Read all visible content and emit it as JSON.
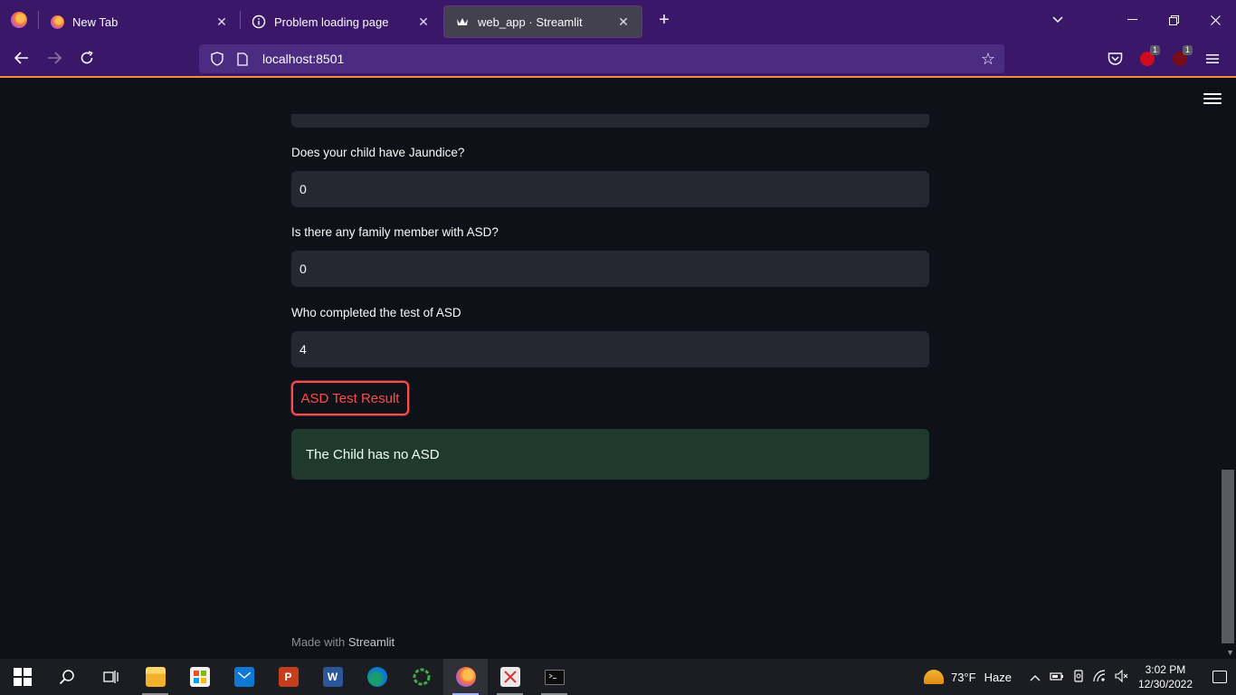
{
  "browser": {
    "tabs": [
      {
        "title": "New Tab",
        "icon": "firefox-icon",
        "active": false
      },
      {
        "title": "Problem loading page",
        "icon": "info-icon",
        "active": false
      },
      {
        "title": "web_app · Streamlit",
        "icon": "streamlit-crown-icon",
        "active": true
      }
    ],
    "url": "localhost:8501",
    "extension_badges": [
      "1",
      "1"
    ]
  },
  "form": {
    "jaundice": {
      "label": "Does your child have Jaundice?",
      "value": "0"
    },
    "family_asd": {
      "label": "Is there any family member with ASD?",
      "value": "0"
    },
    "who_completed": {
      "label": "Who completed the test of ASD",
      "value": "4"
    },
    "submit_label": "ASD Test Result",
    "result_message": "The Child has no ASD"
  },
  "footer": {
    "made_with": "Made with",
    "brand": "Streamlit"
  },
  "taskbar": {
    "apps": [
      "start-icon",
      "search-icon",
      "task-view-icon",
      "file-explorer-icon",
      "microsoft-store-icon",
      "mail-icon",
      "powerpoint-icon",
      "word-icon",
      "edge-icon",
      "loading-app-icon",
      "firefox-icon",
      "snipping-tool-icon",
      "terminal-icon"
    ],
    "weather": {
      "temp": "73°F",
      "condition": "Haze"
    },
    "time": "3:02 PM",
    "date": "12/30/2022"
  },
  "colors": {
    "accent": "#ff4b4b",
    "background": "#0e1117",
    "input_bg": "#262730",
    "success_bg": "#1f3a2c",
    "browser_chrome": "#3b1769"
  }
}
